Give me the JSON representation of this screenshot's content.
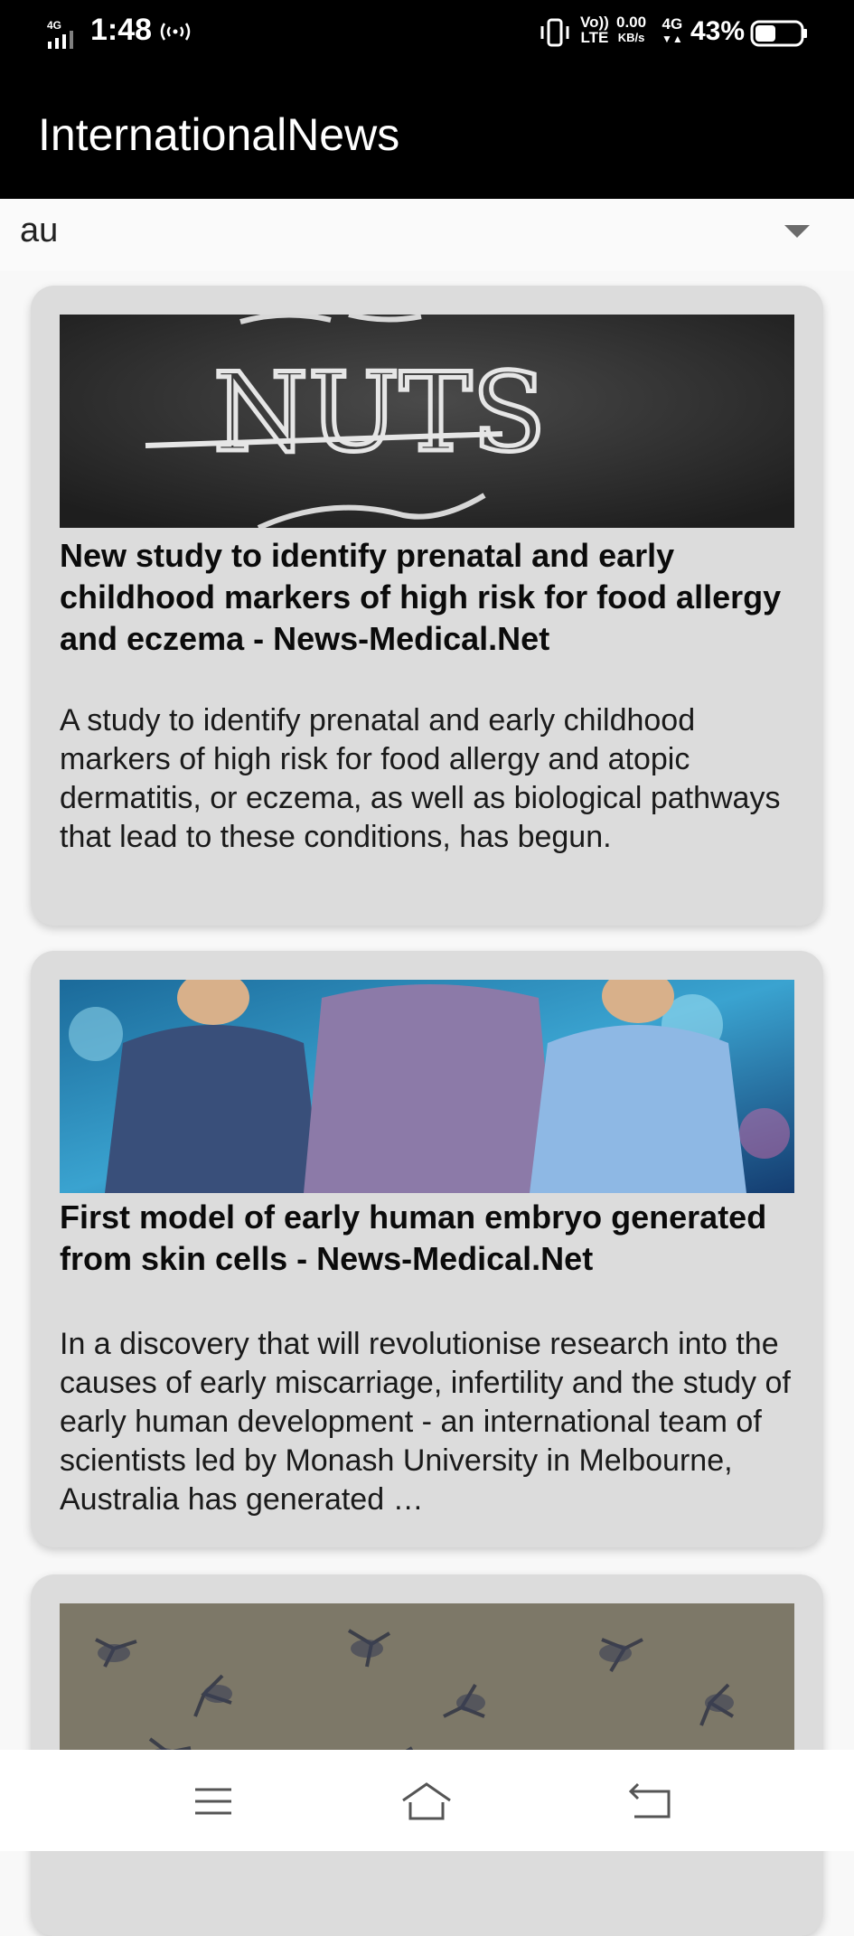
{
  "status_bar": {
    "network": "4G",
    "time": "1:48",
    "volte_top": "Vo))",
    "volte_bottom": "LTE",
    "speed_value": "0.00",
    "speed_unit": "KB/s",
    "net_type": "4G",
    "battery_percent": "43%"
  },
  "app_bar": {
    "title": "InternationalNews"
  },
  "country_select": {
    "value": "au"
  },
  "articles": [
    {
      "title": "New study to identify prenatal and early childhood markers of high risk for food allergy and eczema - News-Medical.Net",
      "description": "A study to identify prenatal and early childhood markers of high risk for food allergy and atopic dermatitis, or eczema, as well as biological pathways that lead to these conditions, has begun.",
      "image_text": "NUTS"
    },
    {
      "title": "First model of early human embryo generated from skin cells - News-Medical.Net",
      "description": "In a discovery that will revolutionise research into the causes of early miscarriage, infertility and the study of early human development - an international team of scientists led by Monash University in Melbourne, Australia has generated …"
    },
    {
      "title": "",
      "description": ""
    }
  ],
  "nav": {
    "menu_icon": "menu-icon",
    "home_icon": "home-icon",
    "back_icon": "back-icon"
  }
}
